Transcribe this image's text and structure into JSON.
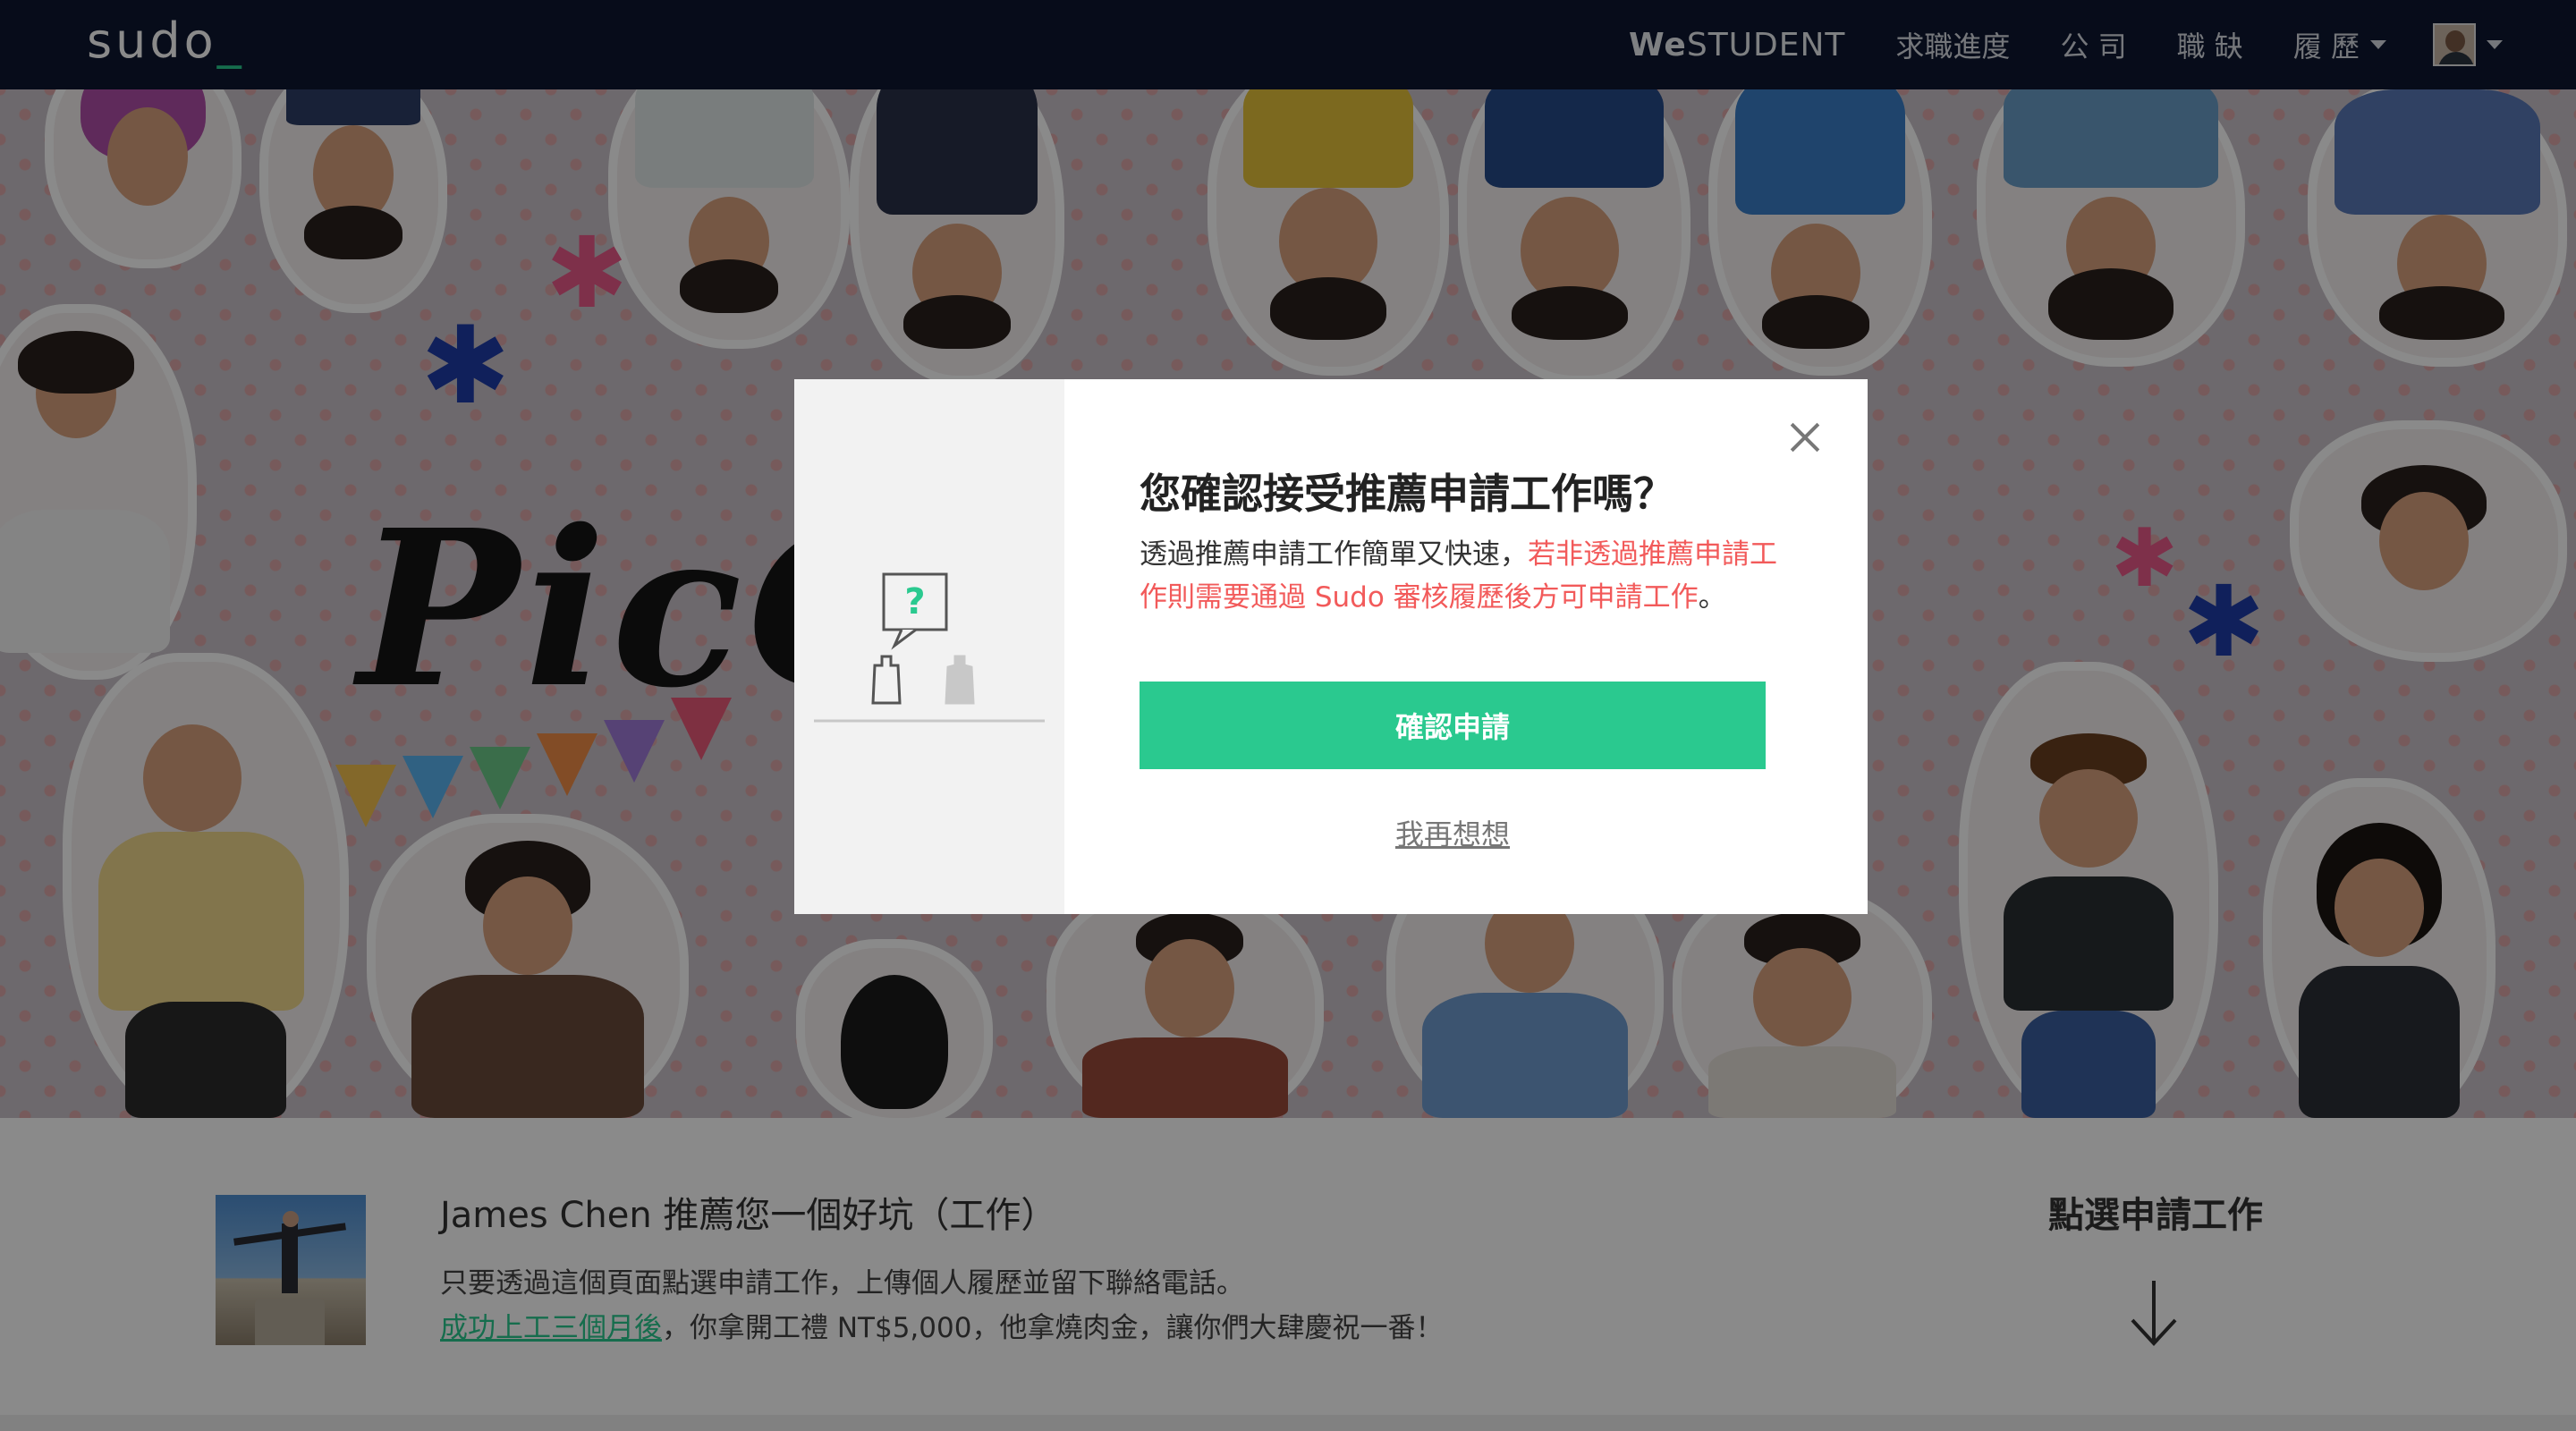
{
  "navbar": {
    "logo": "sudo",
    "logo_cursor": "_",
    "brand_we": "We",
    "brand_student": "STUDENT",
    "items": [
      {
        "label": "求職進度"
      },
      {
        "label": "公 司"
      },
      {
        "label": "職 缺"
      },
      {
        "label": "履 歷"
      }
    ],
    "caret_icon": "chevron-down-icon",
    "avatar_icon": "user-avatar"
  },
  "hero": {
    "banner_text": "PicC",
    "sticker_text": "PicCollage"
  },
  "referral": {
    "title": "James Chen 推薦您一個好坑（工作）",
    "desc_line1": "只要透過這個頁面點選申請工作，上傳個人履歷並留下聯絡電話。",
    "link_text": "成功上工三個月後",
    "desc_line2_rest": "，你拿開工禮 NT$5,000，他拿燒肉金，讓你們大肆慶祝一番！",
    "apply_title": "點選申請工作",
    "arrow_icon": "arrow-down-icon"
  },
  "modal": {
    "title": "您確認接受推薦申請工作嗎？",
    "text_normal": "透過推薦申請工作簡單又快速，",
    "text_warn": "若非透過推薦申請工作則需要通過 Sudo 審核履歷後方可申請工作",
    "text_end": "。",
    "confirm_label": "確認申請",
    "think_label": "我再想想",
    "illustration_mark": "?",
    "close_icon": "close-icon"
  },
  "colors": {
    "navbar": "#0d1730",
    "accent": "#2ac98f",
    "warn": "#f25a5a"
  }
}
